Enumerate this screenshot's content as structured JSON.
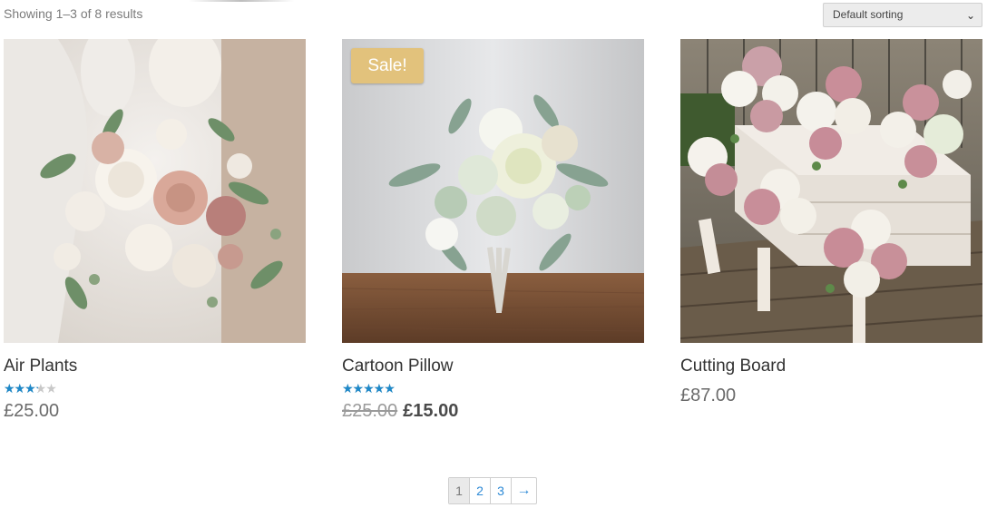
{
  "result_count": "Showing 1–3 of 8 results",
  "sorting": {
    "selected": "Default sorting"
  },
  "products": [
    {
      "title": "Air Plants",
      "rating": 3,
      "rating_max": 5,
      "price": "£25.00"
    },
    {
      "title": "Cartoon Pillow",
      "badge": "Sale!",
      "rating": 5,
      "rating_max": 5,
      "old_price": "£25.00",
      "price": "£15.00"
    },
    {
      "title": "Cutting Board",
      "price": "£87.00"
    }
  ],
  "pagination": {
    "pages": [
      "1",
      "2",
      "3"
    ],
    "current": "1",
    "next": "→"
  },
  "colors": {
    "accent": "#2e8ad6",
    "star": "#1e88c8",
    "sale_badge": "#e2c27c"
  }
}
